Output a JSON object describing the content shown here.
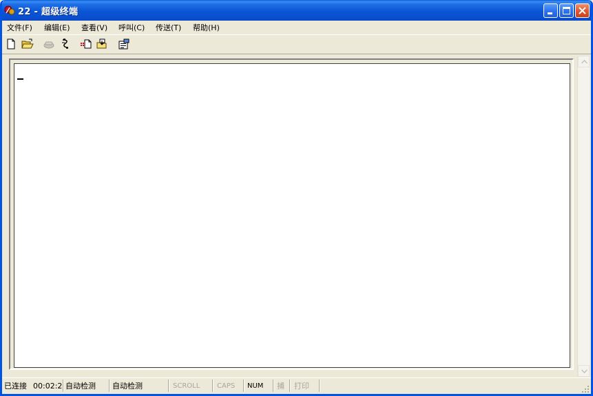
{
  "window": {
    "title": "22 - 超级终端"
  },
  "menu": {
    "items": [
      {
        "label": "文件(F)"
      },
      {
        "label": "编辑(E)"
      },
      {
        "label": "查看(V)"
      },
      {
        "label": "呼叫(C)"
      },
      {
        "label": "传送(T)"
      },
      {
        "label": "帮助(H)"
      }
    ]
  },
  "toolbar": {
    "buttons": [
      {
        "icon": "new-document-icon"
      },
      {
        "icon": "open-folder-icon"
      },
      {
        "icon": "disconnect-phone-icon",
        "enabled": false
      },
      {
        "icon": "call-icon"
      },
      {
        "icon": "send-file-icon"
      },
      {
        "icon": "receive-file-icon"
      },
      {
        "icon": "properties-icon"
      }
    ]
  },
  "status": {
    "connected": "已连接",
    "time": "00:02:2",
    "detect1": "自动检测",
    "detect2": "自动检测",
    "scroll": "SCROLL",
    "caps": "CAPS",
    "num": "NUM",
    "capture": "捕",
    "print": "打印"
  },
  "colors": {
    "titlebar": "#0a55d6",
    "window_border": "#0054e3",
    "chrome": "#ece9d8",
    "close_button": "#e25a34"
  }
}
